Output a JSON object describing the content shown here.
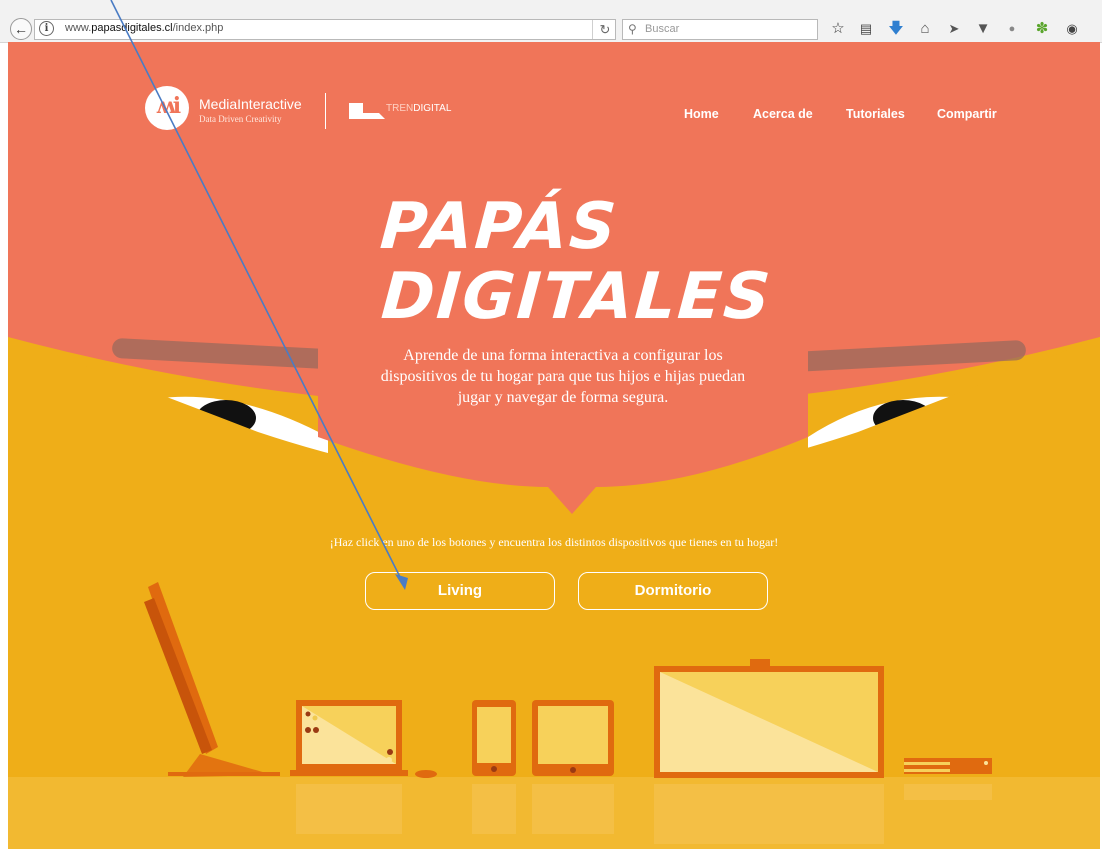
{
  "browser": {
    "url_prefix": "www.",
    "url_domain": "papasdigitales.cl",
    "url_path": "/index.php",
    "search_placeholder": "Buscar",
    "back_icon": "back-arrow-icon",
    "toolbar_icons": [
      "bookmark-star-icon",
      "reading-list-icon",
      "download-icon",
      "home-icon",
      "send-icon",
      "pocket-icon",
      "extension-icon",
      "extension-icon",
      "extension-icon"
    ]
  },
  "header": {
    "brand_name": "MediaInteractive",
    "brand_tagline": "Data Driven Creativity",
    "partner_prefix": "TREN",
    "partner_suffix": "DIGITAL",
    "nav": [
      "Home",
      "Acerca de",
      "Tutoriales",
      "Compartir"
    ]
  },
  "hero": {
    "title_line1": "PAPÁS",
    "title_line2": "DIGITALES",
    "description": "Aprende de una forma interactiva a configurar los dispositivos de tu hogar para que tus hijos e hijas puedan jugar y navegar de forma segura."
  },
  "cta": {
    "text": "¡Haz click en uno de los botones y encuentra los distintos dispositivos que tienes en tu hogar!",
    "buttons": [
      "Living",
      "Dormitorio"
    ]
  },
  "colors": {
    "coral": "#f07559",
    "yellow": "#efae18",
    "device_orange": "#e06a0f",
    "screen": "#f7d15a",
    "arrow": "#4a7cc4"
  }
}
